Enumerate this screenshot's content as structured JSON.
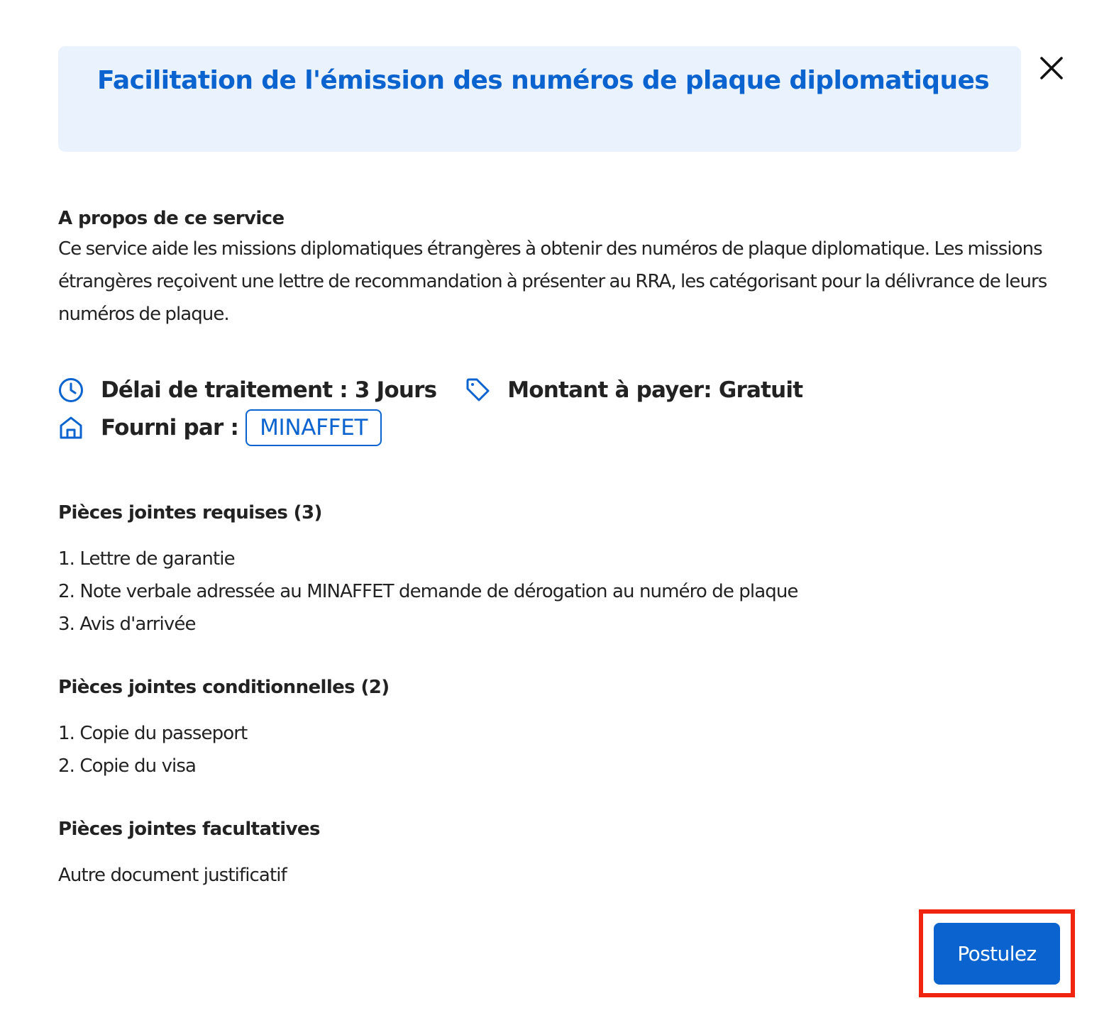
{
  "dialog": {
    "title": "Facilitation de l'émission des numéros de plaque diplomatiques",
    "close_icon": "close-icon"
  },
  "about": {
    "heading": "A propos de ce service",
    "text": "Ce service aide les missions diplomatiques étrangères à obtenir des numéros de plaque diplomatique. Les missions étrangères reçoivent une lettre de recommandation à présenter au RRA, les catégorisant pour la délivrance de leurs numéros de plaque."
  },
  "meta": {
    "processing_time": "Délai de traitement : 3 Jours",
    "amount": "Montant à payer: Gratuit",
    "provided_by_label": "Fourni par :",
    "provider": "MINAFFET",
    "icons": [
      "clock-icon",
      "tag-icon",
      "home-icon"
    ]
  },
  "required": {
    "heading": "Pièces jointes requises (3)",
    "items": [
      "1. Lettre de garantie",
      "2. Note verbale adressée au MINAFFET demande de dérogation au numéro de plaque",
      "3. Avis d'arrivée"
    ]
  },
  "conditional": {
    "heading": "Pièces jointes conditionnelles (2)",
    "items": [
      "1. Copie du passeport",
      "2. Copie du visa"
    ]
  },
  "optional": {
    "heading": "Pièces jointes facultatives",
    "text": "Autre document justificatif"
  },
  "actions": {
    "apply_label": "Postulez"
  },
  "colors": {
    "accent": "#0a63cf",
    "title_background": "#eaf2fd",
    "highlight": "#f0240f",
    "text": "#222222"
  }
}
